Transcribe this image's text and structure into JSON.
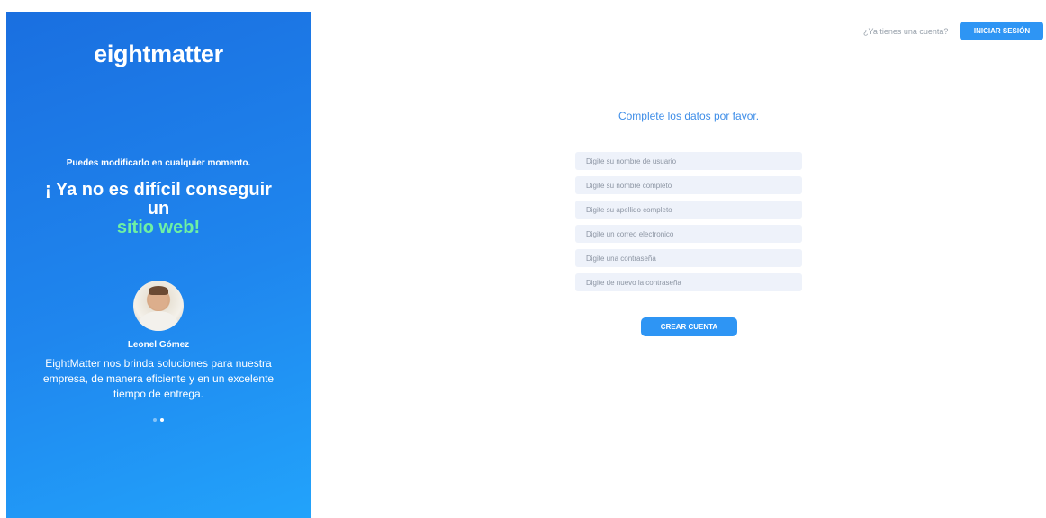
{
  "promo": {
    "brand": "eightmatter",
    "tagline": "Puedes modificarlo en cualquier momento.",
    "headline_line1": "¡ Ya no es difícil conseguir",
    "headline_line2": "un",
    "headline_accent": "sitio web!",
    "accent_color": "#6ef0a3",
    "background_colors": [
      "#1a6fe0",
      "#22a3fb"
    ],
    "person_name": "Leonel Gómez",
    "testimonial": "EightMatter nos brinda soluciones para nuestra empresa, de manera eficiente y en un excelente tiempo de entrega.",
    "carousel": {
      "total": 2,
      "active_index": 1
    }
  },
  "header": {
    "have_account": "¿Ya tienes una cuenta?",
    "login_label": "INICIAR SESIÓN"
  },
  "form": {
    "title": "Complete los datos por favor.",
    "fields": [
      {
        "placeholder": "Digite su nombre de usuario",
        "value": ""
      },
      {
        "placeholder": "Digite su nombre completo",
        "value": ""
      },
      {
        "placeholder": "Digite su apellido completo",
        "value": ""
      },
      {
        "placeholder": "Digite un correo electronico",
        "value": ""
      },
      {
        "placeholder": "Digite una contraseña",
        "value": ""
      },
      {
        "placeholder": "Digite de nuevo la contraseña",
        "value": ""
      }
    ],
    "submit_label": "CREAR CUENTA",
    "primary_color": "#2e95f4"
  }
}
